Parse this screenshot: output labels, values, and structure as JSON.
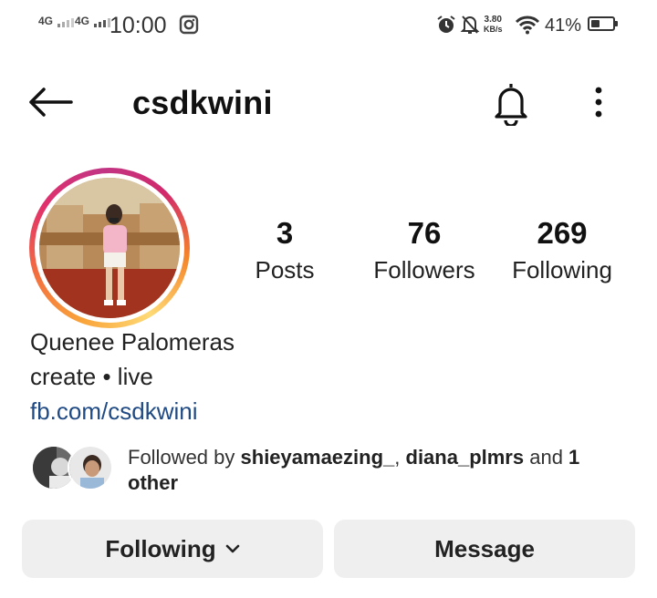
{
  "status_bar": {
    "sim1": "4G",
    "sim2": "4G",
    "time": "10:00",
    "net_speed_value": "3.80",
    "net_speed_unit": "KB/s",
    "battery_text": "41%",
    "battery_level": 0.41,
    "icons": [
      "instagram-notification-icon",
      "alarm-icon",
      "notifications-muted-icon",
      "wifi-icon",
      "battery-icon"
    ]
  },
  "header": {
    "username": "csdkwini",
    "icons": [
      "back-arrow-icon",
      "bell-icon",
      "more-vertical-icon"
    ]
  },
  "stats": {
    "posts": {
      "value": "3",
      "label": "Posts"
    },
    "followers": {
      "value": "76",
      "label": "Followers"
    },
    "following": {
      "value": "269",
      "label": "Following"
    }
  },
  "profile": {
    "full_name": "Quenee Palomeras",
    "bio": "create • live",
    "link": "fb.com/csdkwini"
  },
  "followed_by": {
    "prefix": "Followed by ",
    "user1": "shieyamaezing_",
    "separator": ", ",
    "user2": "diana_plmrs",
    "and_text": " and ",
    "others": "1 other"
  },
  "buttons": {
    "following_label": "Following",
    "message_label": "Message"
  },
  "colors": {
    "link": "#1f4a84",
    "button_bg": "#efefef",
    "story_ring": [
      "#f9a43a",
      "#e1306c",
      "#c13584"
    ]
  }
}
